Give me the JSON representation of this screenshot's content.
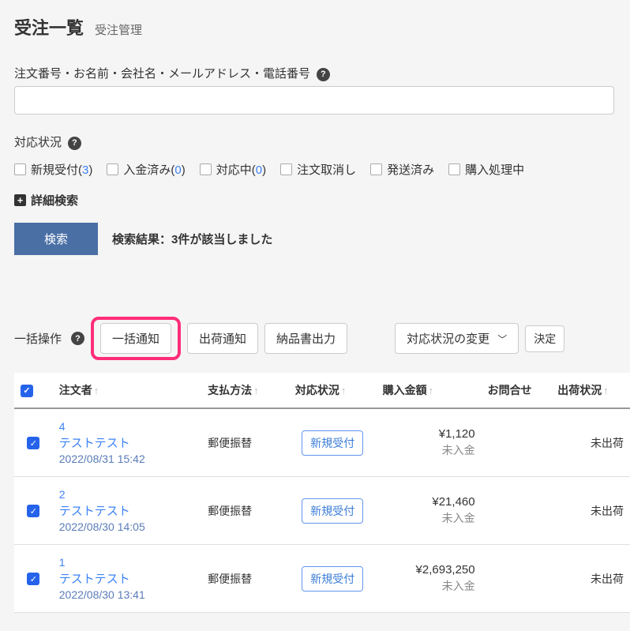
{
  "header": {
    "title": "受注一覧",
    "subtitle": "受注管理"
  },
  "search": {
    "label": "注文番号・お名前・会社名・メールアドレス・電話番号",
    "input_value": "",
    "status_label": "対応状況",
    "statuses": [
      {
        "label": "新規受付",
        "count": "3"
      },
      {
        "label": "入金済み",
        "count": "0"
      },
      {
        "label": "対応中",
        "count": "0"
      },
      {
        "label": "注文取消し",
        "count": ""
      },
      {
        "label": "発送済み",
        "count": ""
      },
      {
        "label": "購入処理中",
        "count": ""
      }
    ],
    "advanced": "詳細検索",
    "button": "検索",
    "results": "検索結果：3件が該当しました"
  },
  "bulk": {
    "label": "一括操作",
    "notify": "一括通知",
    "ship_notify": "出荷通知",
    "delivery_slip": "納品書出力",
    "change_status": "対応状況の変更",
    "decide": "決定"
  },
  "columns": {
    "orderer": "注文者",
    "payment": "支払方法",
    "status": "対応状況",
    "amount": "購入金額",
    "inquiry": "お問合せ",
    "ship": "出荷状況"
  },
  "rows": [
    {
      "id": "4",
      "name": "テストテスト",
      "date": "2022/08/31 15:42",
      "payment": "郵便振替",
      "status": "新規受付",
      "amount": "¥1,120",
      "pay_status": "未入金",
      "ship": "未出荷"
    },
    {
      "id": "2",
      "name": "テストテスト",
      "date": "2022/08/30 14:05",
      "payment": "郵便振替",
      "status": "新規受付",
      "amount": "¥21,460",
      "pay_status": "未入金",
      "ship": "未出荷"
    },
    {
      "id": "1",
      "name": "テストテスト",
      "date": "2022/08/30 13:41",
      "payment": "郵便振替",
      "status": "新規受付",
      "amount": "¥2,693,250",
      "pay_status": "未入金",
      "ship": "未出荷"
    }
  ]
}
